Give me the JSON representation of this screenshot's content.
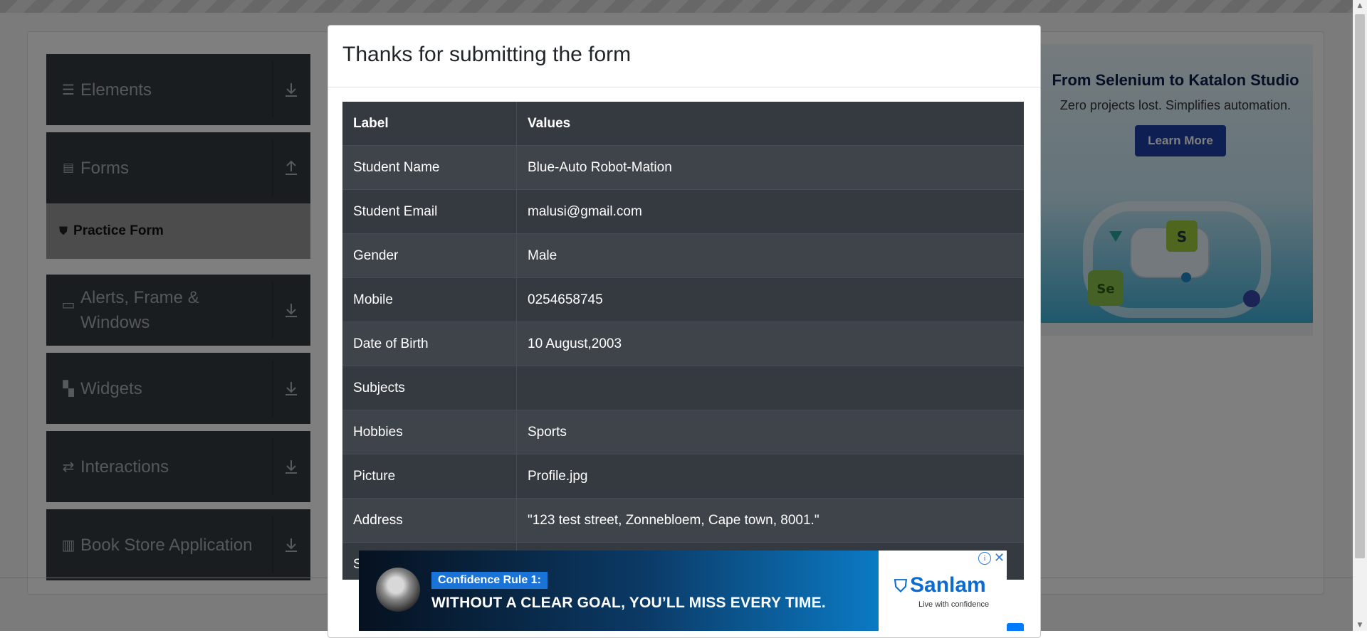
{
  "sidebar": {
    "groups": [
      {
        "label": "Elements",
        "icon": "hamburger-icon",
        "arrow": "download-icon"
      },
      {
        "label": "Forms",
        "icon": "document-icon",
        "arrow": "upload-icon"
      },
      {
        "label": "Alerts, Frame & Windows",
        "icon": "window-icon",
        "arrow": "download-icon"
      },
      {
        "label": "Widgets",
        "icon": "widgets-icon",
        "arrow": "download-icon"
      },
      {
        "label": "Interactions",
        "icon": "interactions-icon",
        "arrow": "download-icon"
      },
      {
        "label": "Book Store Application",
        "icon": "books-icon",
        "arrow": "download-icon"
      }
    ],
    "active_item": {
      "label": "Practice Form",
      "icon": "html5-icon"
    }
  },
  "side_ad": {
    "title": "From Selenium to Katalon Studio",
    "subtitle": "Zero projects lost. Simplifies automation.",
    "button": "Learn More"
  },
  "modal": {
    "title": "Thanks for submitting the form",
    "table": {
      "headers": [
        "Label",
        "Values"
      ],
      "rows": [
        [
          "Student Name",
          "Blue-Auto Robot-Mation"
        ],
        [
          "Student Email",
          "malusi@gmail.com"
        ],
        [
          "Gender",
          "Male"
        ],
        [
          "Mobile",
          "0254658745"
        ],
        [
          "Date of Birth",
          "10 August,2003"
        ],
        [
          "Subjects",
          ""
        ],
        [
          "Hobbies",
          "Sports"
        ],
        [
          "Picture",
          "Profile.jpg"
        ],
        [
          "Address",
          "\"123 test street, Zonnebloem, Cape town, 8001.\""
        ]
      ],
      "partial_row_label": "S"
    }
  },
  "bottom_ad": {
    "tag": "Confidence Rule 1:",
    "headline": "WITHOUT A CLEAR GOAL, YOU’LL MISS EVERY TIME.",
    "brand": "Sanlam",
    "brand_tagline": "Live with confidence",
    "info_glyph": "i",
    "close_glyph": "✕"
  },
  "colors": {
    "sidebar_bg": "#343a40",
    "table_odd": "#3e444a",
    "table_even": "#343a40",
    "overlay": "rgba(0,0,0,0.5)",
    "primary": "#007bff"
  }
}
